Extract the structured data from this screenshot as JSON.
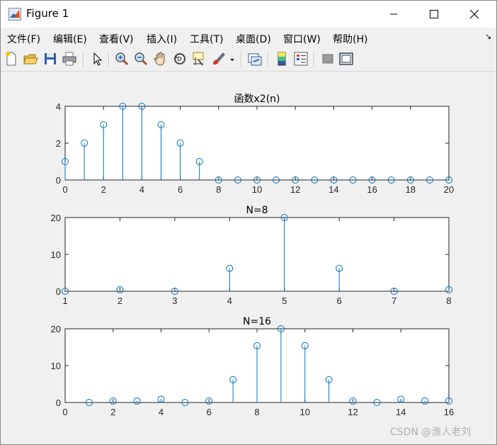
{
  "window": {
    "title": "Figure 1",
    "controls": [
      "minimize",
      "maximize",
      "close"
    ]
  },
  "menu": {
    "items": [
      "文件(F)",
      "编辑(E)",
      "查看(V)",
      "插入(I)",
      "工具(T)",
      "桌面(D)",
      "窗口(W)",
      "帮助(H)"
    ]
  },
  "toolbar": {
    "buttons": [
      "new-figure-icon",
      "open-file-icon",
      "save-icon",
      "print-icon",
      "pointer-icon",
      "zoom-in-icon",
      "zoom-out-icon",
      "pan-hand-icon",
      "rotate-3d-icon",
      "data-cursor-icon",
      "brush-icon",
      "link-plot-icon",
      "colorbar-icon",
      "legend-icon",
      "hide-plot-tools-icon",
      "show-plot-tools-icon"
    ]
  },
  "colors": {
    "stem": "#0072bd",
    "axes": "#262626",
    "figure_bg": "#f0f0f0",
    "axes_bg": "#ffffff"
  },
  "chart_data": [
    {
      "type": "stem",
      "title": "函数x2(n)",
      "xlim": [
        0,
        20
      ],
      "ylim": [
        0,
        4
      ],
      "xticks": [
        0,
        2,
        4,
        6,
        8,
        10,
        12,
        14,
        16,
        18,
        20
      ],
      "yticks": [
        0,
        2,
        4
      ],
      "x": [
        0,
        1,
        2,
        3,
        4,
        5,
        6,
        7,
        8,
        9,
        10,
        11,
        12,
        13,
        14,
        15,
        16,
        17,
        18,
        19,
        20
      ],
      "y": [
        1,
        2,
        3,
        4,
        4,
        3,
        2,
        1,
        0,
        0,
        0,
        0,
        0,
        0,
        0,
        0,
        0,
        0,
        0,
        0,
        0
      ]
    },
    {
      "type": "stem",
      "title": "N=8",
      "xlim": [
        1,
        8
      ],
      "ylim": [
        0,
        20
      ],
      "xticks": [
        1,
        2,
        3,
        4,
        5,
        6,
        7,
        8
      ],
      "yticks": [
        0,
        10,
        20
      ],
      "x": [
        1,
        2,
        3,
        4,
        5,
        6,
        7,
        8
      ],
      "y": [
        0,
        0.4,
        0,
        6.2,
        20,
        6.2,
        0,
        0.4
      ]
    },
    {
      "type": "stem",
      "title": "N=16",
      "xlim": [
        0,
        16
      ],
      "ylim": [
        0,
        20
      ],
      "xticks": [
        0,
        2,
        4,
        6,
        8,
        10,
        12,
        14,
        16
      ],
      "yticks": [
        0,
        10,
        20
      ],
      "x": [
        1,
        2,
        3,
        4,
        5,
        6,
        7,
        8,
        9,
        10,
        11,
        12,
        13,
        14,
        15,
        16
      ],
      "y": [
        0,
        0.4,
        0.4,
        0.9,
        0,
        0.4,
        6.2,
        15.4,
        20,
        15.4,
        6.2,
        0.4,
        0,
        0.9,
        0.4,
        0.4
      ]
    }
  ],
  "watermark": "CSDN @渔人老刘"
}
